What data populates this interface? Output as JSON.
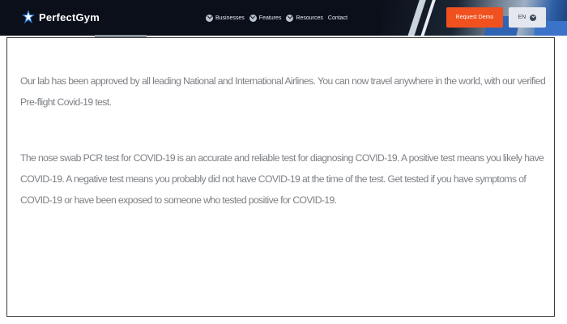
{
  "navbar": {
    "brand": "PerfectGym",
    "links": [
      {
        "label": "Businesses",
        "icon": "chevron-down-icon"
      },
      {
        "label": "Features",
        "icon": "chevron-down-icon"
      },
      {
        "label": "Resources",
        "icon": "chevron-down-icon"
      },
      {
        "label": "Contact"
      }
    ],
    "cta_label": "Request Demo",
    "language": "EN"
  },
  "content": {
    "paragraph1": "Our lab has been approved by all leading National and International Airlines. You can now travel anywhere in the world, with our verified Pre-flight Covid-19 test.",
    "paragraph2": "The nose swab PCR test for COVID-19 is an accurate and reliable test for diagnosing COVID-19. A positive test means you likely have COVID-19. A negative test means you probably did not have COVID-19 at the time of the test. Get tested if you have symptoms of COVID-19 or have been exposed to someone who tested positive for COVID-19."
  },
  "colors": {
    "navbar_bg": "#0b0f1a",
    "cta_bg": "#f0511e",
    "lang_bg": "#e4e8ee",
    "logo_accent": "#2f7fe0",
    "body_text": "#7d8085"
  }
}
